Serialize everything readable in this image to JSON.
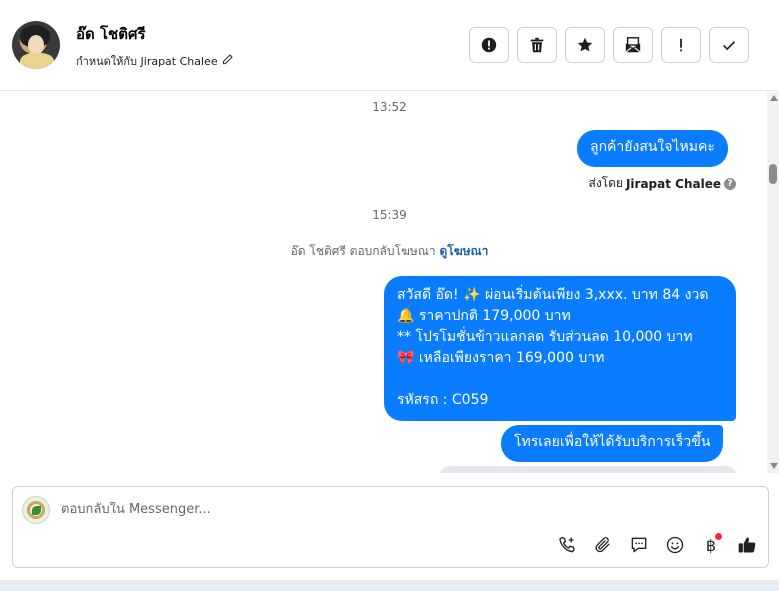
{
  "header": {
    "contact_name": "อ๊ด โชติศรี",
    "assigned_label": "กำหนดให้กับ Jirapat Chalee",
    "actions": [
      {
        "icon": "alert-circle-icon",
        "label": ""
      },
      {
        "icon": "trash-icon",
        "label": ""
      },
      {
        "icon": "star-icon",
        "label": ""
      },
      {
        "icon": "mark-unread-envelope-icon",
        "label": ""
      },
      {
        "icon": "exclamation-icon",
        "label": ""
      },
      {
        "icon": "check-icon",
        "label": ""
      }
    ]
  },
  "conversation": {
    "timestamp_1": "13:52",
    "message_1": "ลูกค้ายังสนใจไหมคะ",
    "sent_by_prefix": "ส่งโดย",
    "sent_by_name": "Jirapat Chalee",
    "timestamp_2": "15:39",
    "ad_reply_note": "อ๊ด โชติศรี ตอบกลับโฆษณา",
    "ad_reply_link": "ดูโฆษณา",
    "message_2_lines": [
      "สวัสดี อ๊ด! ✨  ผ่อนเริ่มต้นเพียง 3,xxx. บาท 84 งวด",
      "🔔 ราคาปกติ 179,000 บาท",
      "** โปรโมชั่นข้าวแลกลด รับส่วนลด 10,000 บาท",
      "🎀  เหลือเพียงราคา 169,000 บาท",
      "",
      "รหัสรถ : C059"
    ],
    "message_3": "โทรเลยเพื่อให้ได้รับบริการเร็วขึ้น"
  },
  "composer": {
    "placeholder": "ตอบกลับใน Messenger...",
    "tools": [
      "call-add-icon",
      "attachment-icon",
      "chat-bubble-icon",
      "emoji-icon",
      "baht-payment-icon",
      "thumbs-up-icon"
    ],
    "baht_symbol": "฿"
  },
  "colors": {
    "bubble": "#0a7cff",
    "link": "#1a5fa8",
    "notification_dot": "#f02849"
  }
}
